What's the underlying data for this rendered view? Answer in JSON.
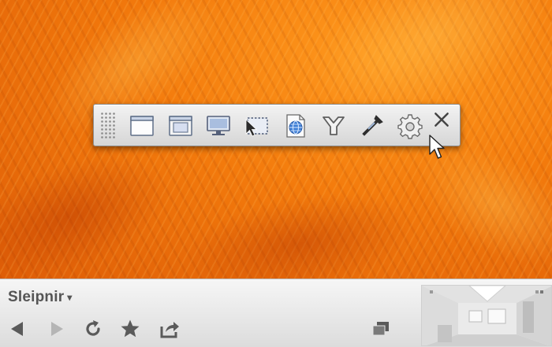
{
  "toolbar": {
    "tools": [
      {
        "icon": "window-icon"
      },
      {
        "icon": "window-client-icon"
      },
      {
        "icon": "screen-icon"
      },
      {
        "icon": "region-select-icon"
      },
      {
        "icon": "web-page-icon"
      },
      {
        "icon": "funnel-icon"
      },
      {
        "icon": "eyedropper-icon"
      },
      {
        "icon": "gear-icon"
      },
      {
        "icon": "close-icon"
      }
    ]
  },
  "browser": {
    "app_name": "Sleipnir",
    "app_menu_caret": "▾"
  },
  "colors": {
    "accent_orange": "#f07a0c",
    "toolbar_bg": "#e4e4e4",
    "icon_gray": "#5f5f5f",
    "icon_blue": "#3f7fd6"
  }
}
